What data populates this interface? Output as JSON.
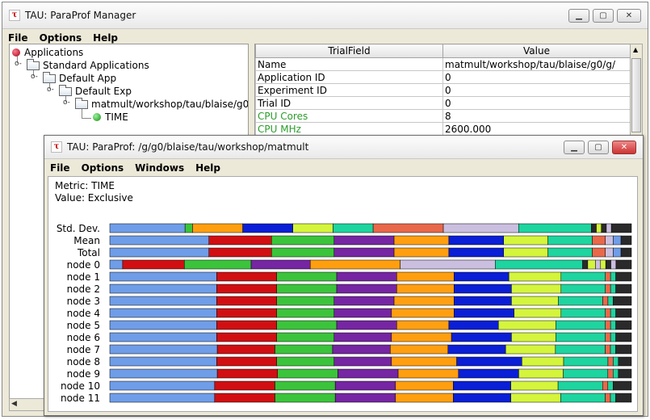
{
  "manager": {
    "title": "TAU: ParaProf Manager",
    "menu": [
      "File",
      "Options",
      "Help"
    ],
    "tree": {
      "root": "Applications",
      "standard": "Standard Applications",
      "app": "Default App",
      "exp": "Default Exp",
      "trial": "matmult/workshop/tau/blaise/g0",
      "metric": "TIME"
    },
    "table": {
      "headers": [
        "TrialField",
        "Value"
      ],
      "rows": [
        {
          "field": "Name",
          "value": "matmult/workshop/tau/blaise/g0/g/",
          "green": false
        },
        {
          "field": "Application ID",
          "value": "0",
          "green": false
        },
        {
          "field": "Experiment ID",
          "value": "0",
          "green": false
        },
        {
          "field": "Trial ID",
          "value": "0",
          "green": false
        },
        {
          "field": "CPU Cores",
          "value": "8",
          "green": true
        },
        {
          "field": "CPU MHz",
          "value": "2600.000",
          "green": true
        }
      ]
    }
  },
  "paraprof": {
    "title": "TAU: ParaProf: /g/g0/blaise/tau/workshop/matmult",
    "menu": [
      "File",
      "Options",
      "Windows",
      "Help"
    ],
    "metric_line": "Metric: TIME",
    "value_line": "Value: Exclusive"
  },
  "colors": {
    "palette": [
      "#6f9de8",
      "#d10f12",
      "#3bc43b",
      "#7625a3",
      "#ff9f10",
      "#0a1fd6",
      "#d4f53c",
      "#1ed49f",
      "#e8684a",
      "#cbbfe0",
      "#2a2a2a",
      "#c9c9c9"
    ]
  },
  "chart_data": {
    "type": "bar",
    "orientation": "horizontal-stacked",
    "categories": [
      "Std. Dev.",
      "Mean",
      "Total",
      "node 0",
      "node 1",
      "node 2",
      "node 3",
      "node 4",
      "node 5",
      "node 6",
      "node 7",
      "node 8",
      "node 9",
      "node 10",
      "node 11"
    ],
    "series_colors": [
      "#6f9de8",
      "#d10f12",
      "#3bc43b",
      "#7625a3",
      "#ff9f10",
      "#0a1fd6",
      "#d4f53c",
      "#1ed49f",
      "#e8684a",
      "#cbbfe0",
      "#2a2a2a"
    ],
    "rows": [
      [
        [
          "#6f9de8",
          15
        ],
        [
          "#3bc43b",
          1.5
        ],
        [
          "#ff9f10",
          10
        ],
        [
          "#0a1fd6",
          10
        ],
        [
          "#d4f53c",
          8
        ],
        [
          "#1ed49f",
          8
        ],
        [
          "#e8684a",
          14
        ],
        [
          "#cbbfe0",
          15
        ],
        [
          "#1ed49f",
          14.5
        ],
        [
          "#2a2a2a",
          1
        ],
        [
          "#d4f53c",
          1
        ],
        [
          "#2a2a2a",
          1
        ],
        [
          "#cbbfe0",
          1
        ],
        [
          "#2a2a2a",
          4
        ]
      ],
      [
        [
          "#6f9de8",
          19
        ],
        [
          "#d10f12",
          12
        ],
        [
          "#3bc43b",
          12
        ],
        [
          "#7625a3",
          11.5
        ],
        [
          "#ff9f10",
          10.5
        ],
        [
          "#0a1fd6",
          10.5
        ],
        [
          "#d4f53c",
          8.5
        ],
        [
          "#1ed49f",
          8.5
        ],
        [
          "#e8684a",
          2.5
        ],
        [
          "#cbbfe0",
          1.5
        ],
        [
          "#6f9de8",
          1.5
        ],
        [
          "#2a2a2a",
          2
        ]
      ],
      [
        [
          "#6f9de8",
          19
        ],
        [
          "#d10f12",
          12
        ],
        [
          "#3bc43b",
          12
        ],
        [
          "#7625a3",
          11.5
        ],
        [
          "#ff9f10",
          10.5
        ],
        [
          "#0a1fd6",
          10.5
        ],
        [
          "#d4f53c",
          8.5
        ],
        [
          "#1ed49f",
          8.5
        ],
        [
          "#e8684a",
          2.5
        ],
        [
          "#cbbfe0",
          1.5
        ],
        [
          "#6f9de8",
          1.5
        ],
        [
          "#2a2a2a",
          2
        ]
      ],
      [
        [
          "#6f9de8",
          2.5
        ],
        [
          "#d10f12",
          12
        ],
        [
          "#3bc43b",
          13
        ],
        [
          "#7625a3",
          11.5
        ],
        [
          "#ff9f10",
          17.5
        ],
        [
          "#cbbfe0",
          18.5
        ],
        [
          "#1ed49f",
          17
        ],
        [
          "#2a2a2a",
          1
        ],
        [
          "#d4f53c",
          1.5
        ],
        [
          "#cbbfe0",
          1
        ],
        [
          "#d4f53c",
          1
        ],
        [
          "#2a2a2a",
          1
        ],
        [
          "#cbbfe0",
          1
        ],
        [
          "#2a2a2a",
          3
        ]
      ],
      [
        [
          "#6f9de8",
          20.5
        ],
        [
          "#d10f12",
          11.5
        ],
        [
          "#3bc43b",
          11.5
        ],
        [
          "#7625a3",
          11.5
        ],
        [
          "#ff9f10",
          11
        ],
        [
          "#0a1fd6",
          10.5
        ],
        [
          "#d4f53c",
          10
        ],
        [
          "#1ed49f",
          8.5
        ],
        [
          "#e8684a",
          1
        ],
        [
          "#1ed49f",
          1
        ],
        [
          "#2a2a2a",
          3
        ]
      ],
      [
        [
          "#6f9de8",
          20.5
        ],
        [
          "#d10f12",
          11.5
        ],
        [
          "#3bc43b",
          11.5
        ],
        [
          "#7625a3",
          11.5
        ],
        [
          "#ff9f10",
          11
        ],
        [
          "#0a1fd6",
          11
        ],
        [
          "#d4f53c",
          9.5
        ],
        [
          "#1ed49f",
          8.5
        ],
        [
          "#e8684a",
          1
        ],
        [
          "#1ed49f",
          1
        ],
        [
          "#2a2a2a",
          3
        ]
      ],
      [
        [
          "#6f9de8",
          20.5
        ],
        [
          "#d10f12",
          11.5
        ],
        [
          "#3bc43b",
          11
        ],
        [
          "#7625a3",
          11.5
        ],
        [
          "#ff9f10",
          11.5
        ],
        [
          "#0a1fd6",
          11
        ],
        [
          "#d4f53c",
          9
        ],
        [
          "#1ed49f",
          8.5
        ],
        [
          "#e8684a",
          1
        ],
        [
          "#1ed49f",
          1
        ],
        [
          "#2a2a2a",
          3.5
        ]
      ],
      [
        [
          "#6f9de8",
          20.5
        ],
        [
          "#d10f12",
          11.5
        ],
        [
          "#3bc43b",
          11
        ],
        [
          "#7625a3",
          11
        ],
        [
          "#ff9f10",
          12
        ],
        [
          "#0a1fd6",
          11.5
        ],
        [
          "#d4f53c",
          9
        ],
        [
          "#1ed49f",
          8.5
        ],
        [
          "#e8684a",
          1
        ],
        [
          "#1ed49f",
          1
        ],
        [
          "#2a2a2a",
          3
        ]
      ],
      [
        [
          "#6f9de8",
          20.5
        ],
        [
          "#d10f12",
          11.5
        ],
        [
          "#3bc43b",
          11.5
        ],
        [
          "#7625a3",
          11.5
        ],
        [
          "#ff9f10",
          10
        ],
        [
          "#0a1fd6",
          9.5
        ],
        [
          "#d4f53c",
          11
        ],
        [
          "#1ed49f",
          9.5
        ],
        [
          "#e8684a",
          1
        ],
        [
          "#1ed49f",
          1
        ],
        [
          "#2a2a2a",
          3
        ]
      ],
      [
        [
          "#6f9de8",
          20.5
        ],
        [
          "#d10f12",
          11.5
        ],
        [
          "#3bc43b",
          11
        ],
        [
          "#7625a3",
          11
        ],
        [
          "#ff9f10",
          11.5
        ],
        [
          "#0a1fd6",
          11.5
        ],
        [
          "#d4f53c",
          8.5
        ],
        [
          "#1ed49f",
          9.5
        ],
        [
          "#e8684a",
          1
        ],
        [
          "#1ed49f",
          1
        ],
        [
          "#2a2a2a",
          3
        ]
      ],
      [
        [
          "#6f9de8",
          20.5
        ],
        [
          "#d10f12",
          11
        ],
        [
          "#3bc43b",
          11
        ],
        [
          "#7625a3",
          11
        ],
        [
          "#ff9f10",
          11
        ],
        [
          "#0a1fd6",
          11
        ],
        [
          "#d4f53c",
          9.5
        ],
        [
          "#1ed49f",
          9.5
        ],
        [
          "#e8684a",
          1
        ],
        [
          "#1ed49f",
          1
        ],
        [
          "#2a2a2a",
          3
        ]
      ],
      [
        [
          "#6f9de8",
          20.5
        ],
        [
          "#d10f12",
          11.5
        ],
        [
          "#3bc43b",
          11
        ],
        [
          "#7625a3",
          11
        ],
        [
          "#ff9f10",
          12.5
        ],
        [
          "#0a1fd6",
          12.5
        ],
        [
          "#d4f53c",
          8
        ],
        [
          "#1ed49f",
          8.5
        ],
        [
          "#e8684a",
          1
        ],
        [
          "#1ed49f",
          1
        ],
        [
          "#2a2a2a",
          2.5
        ]
      ],
      [
        [
          "#6f9de8",
          20.5
        ],
        [
          "#d10f12",
          11.5
        ],
        [
          "#3bc43b",
          11.5
        ],
        [
          "#7625a3",
          11.5
        ],
        [
          "#ff9f10",
          11.5
        ],
        [
          "#0a1fd6",
          11.5
        ],
        [
          "#d4f53c",
          8.5
        ],
        [
          "#1ed49f",
          8.5
        ],
        [
          "#e8684a",
          1
        ],
        [
          "#1ed49f",
          1
        ],
        [
          "#2a2a2a",
          2.5
        ]
      ],
      [
        [
          "#6f9de8",
          20
        ],
        [
          "#d10f12",
          11.5
        ],
        [
          "#3bc43b",
          11.5
        ],
        [
          "#7625a3",
          11.5
        ],
        [
          "#ff9f10",
          11
        ],
        [
          "#0a1fd6",
          11
        ],
        [
          "#d4f53c",
          9
        ],
        [
          "#1ed49f",
          8.5
        ],
        [
          "#e8684a",
          1
        ],
        [
          "#1ed49f",
          1
        ],
        [
          "#2a2a2a",
          3.5
        ]
      ],
      [
        [
          "#6f9de8",
          20
        ],
        [
          "#d10f12",
          11.5
        ],
        [
          "#3bc43b",
          11.5
        ],
        [
          "#7625a3",
          11.5
        ],
        [
          "#ff9f10",
          11
        ],
        [
          "#0a1fd6",
          11
        ],
        [
          "#d4f53c",
          9.5
        ],
        [
          "#1ed49f",
          8.5
        ],
        [
          "#e8684a",
          1
        ],
        [
          "#1ed49f",
          1
        ],
        [
          "#2a2a2a",
          3
        ]
      ]
    ]
  }
}
